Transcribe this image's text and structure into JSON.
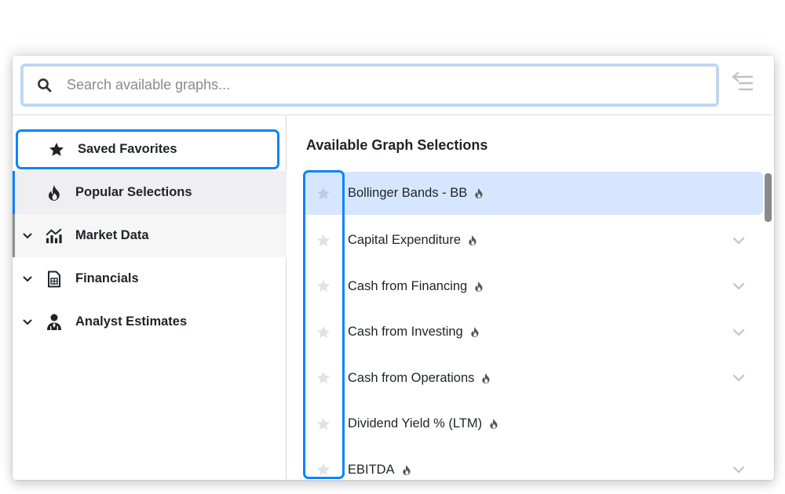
{
  "search": {
    "placeholder": "Search available graphs...",
    "value": ""
  },
  "toolbar": {
    "collapse_icon": "collapse-menu-icon"
  },
  "sidebar": {
    "items": [
      {
        "label": "Saved Favorites",
        "icon": "star-icon",
        "expandable": false,
        "focused": true
      },
      {
        "label": "Popular Selections",
        "icon": "fire-icon",
        "expandable": false,
        "selected": true
      },
      {
        "label": "Market Data",
        "icon": "chart-icon",
        "expandable": true
      },
      {
        "label": "Financials",
        "icon": "spreadsheet-icon",
        "expandable": true
      },
      {
        "label": "Analyst Estimates",
        "icon": "analyst-icon",
        "expandable": true
      }
    ]
  },
  "main": {
    "title": "Available Graph Selections",
    "items": [
      {
        "label": "Bollinger Bands - BB",
        "popular": true,
        "favorite": false,
        "expandable": false,
        "highlighted": true
      },
      {
        "label": "Capital Expenditure",
        "popular": true,
        "favorite": false,
        "expandable": true
      },
      {
        "label": "Cash from Financing",
        "popular": true,
        "favorite": false,
        "expandable": true
      },
      {
        "label": "Cash from Investing",
        "popular": true,
        "favorite": false,
        "expandable": true
      },
      {
        "label": "Cash from Operations",
        "popular": true,
        "favorite": false,
        "expandable": true
      },
      {
        "label": "Dividend Yield % (LTM)",
        "popular": true,
        "favorite": false,
        "expandable": false
      },
      {
        "label": "EBITDA",
        "popular": true,
        "favorite": false,
        "expandable": true
      }
    ]
  },
  "colors": {
    "accent": "#0a84ff",
    "highlight_row": "#d6e6ff",
    "search_focus": "#b9d8f7",
    "text": "#1f2329",
    "muted_icon": "#c7c7cc"
  }
}
